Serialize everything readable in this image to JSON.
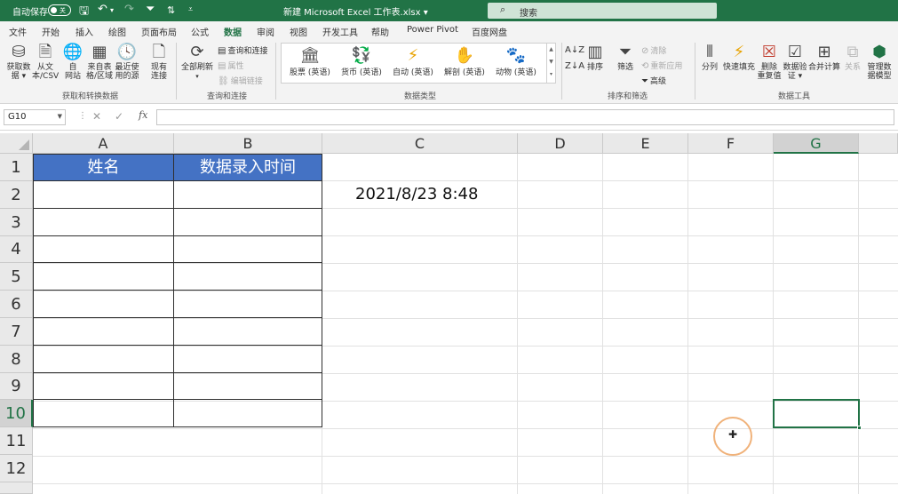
{
  "titlebar": {
    "autosave_label": "自动保存",
    "autosave_state": "关",
    "doc_title": "新建 Microsoft Excel 工作表.xlsx",
    "search_placeholder": "搜索"
  },
  "menu": {
    "tabs": [
      "文件",
      "开始",
      "插入",
      "绘图",
      "页面布局",
      "公式",
      "数据",
      "审阅",
      "视图",
      "开发工具",
      "帮助",
      "Power Pivot",
      "百度网盘"
    ],
    "active": "数据"
  },
  "ribbon": {
    "get_data": {
      "buttons": [
        "获取数\n据 ▾",
        "从文\n本/CSV",
        "自\n网站",
        "来自表\n格/区域",
        "最近使\n用的源",
        "现有\n连接"
      ],
      "label": "获取和转换数据"
    },
    "query": {
      "refresh": "全部刷新",
      "items": [
        "查询和连接",
        "属性",
        "编辑链接"
      ],
      "label": "查询和连接"
    },
    "datatypes": {
      "items": [
        "股票 (英语)",
        "货币 (英语)",
        "自动 (英语)",
        "解剖 (英语)",
        "动物 (英语)"
      ],
      "label": "数据类型"
    },
    "sort": {
      "sort": "排序",
      "filter": "筛选",
      "small": [
        "清除",
        "重新应用",
        "高级"
      ],
      "label": "排序和筛选"
    },
    "tools": {
      "buttons": [
        "分列",
        "快速填充",
        "删除\n重复值",
        "数据验\n证 ▾",
        "合并计算",
        "关系",
        "管理数\n据模型"
      ],
      "label": "数据工具"
    }
  },
  "formula_bar": {
    "name_box": "G10",
    "fx": "fx",
    "content": ""
  },
  "sheet": {
    "columns": [
      "A",
      "B",
      "C",
      "D",
      "E",
      "F",
      "G"
    ],
    "rows": [
      "1",
      "2",
      "3",
      "4",
      "5",
      "6",
      "7",
      "8",
      "9",
      "10",
      "11",
      "12"
    ],
    "selected_cell": "G10",
    "header_a": "姓名",
    "header_b": "数据录入时间",
    "c2_value": "2021/8/23 8:48",
    "header_fill": "#4472c4",
    "accent": "#217346"
  }
}
